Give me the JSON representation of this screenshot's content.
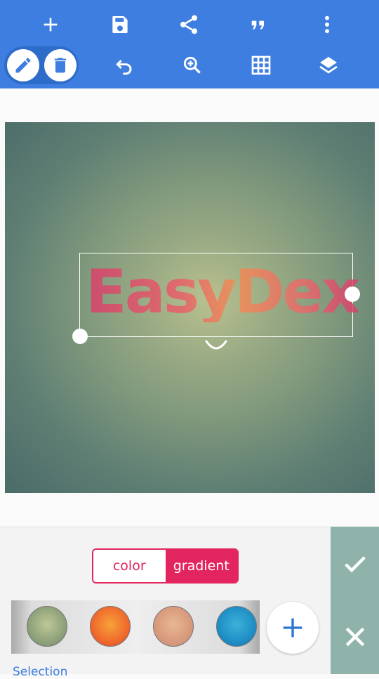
{
  "toolbar": {
    "top_icons": [
      "plus-icon",
      "save-icon",
      "share-icon",
      "quote-icon",
      "more-vertical-icon"
    ],
    "bottom_icons": [
      "pencil-icon",
      "trash-icon",
      "undo-icon",
      "zoom-in-icon",
      "grid-icon",
      "layers-icon"
    ]
  },
  "canvas": {
    "text": "EasyDex",
    "text_gradient": [
      "#d8406c",
      "#f08d56",
      "#d8406c"
    ]
  },
  "fill_mode": {
    "color_label": "color",
    "gradient_label": "gradient",
    "selected": "gradient"
  },
  "swatches": [
    "#9fb082",
    "#ef6a2c",
    "#d79a7c",
    "#1f8fc6"
  ],
  "selection_label": "Selection",
  "colors": {
    "toolbar": "#3d7ee0",
    "accent": "#e3255f",
    "side_panel": "#8fb3aa"
  }
}
